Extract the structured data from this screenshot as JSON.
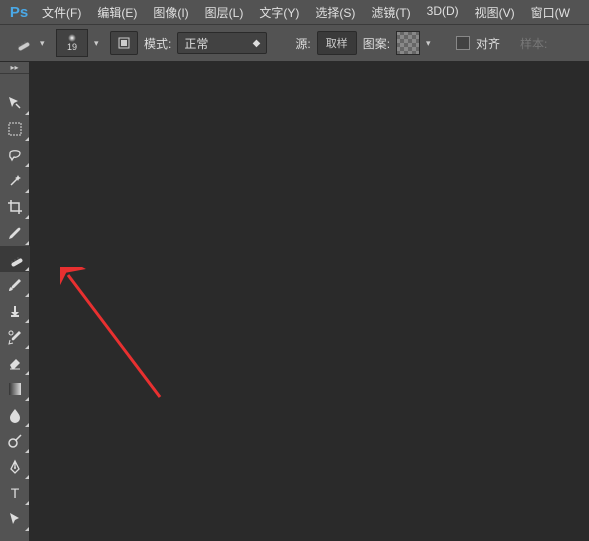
{
  "app": {
    "logo": "Ps"
  },
  "menu": {
    "file": "文件(F)",
    "edit": "编辑(E)",
    "image": "图像(I)",
    "layer": "图层(L)",
    "type": "文字(Y)",
    "select": "选择(S)",
    "filter": "滤镜(T)",
    "threeD": "3D(D)",
    "view": "视图(V)",
    "window": "窗口(W"
  },
  "options": {
    "brush_size": "19",
    "mode_label": "模式:",
    "mode_value": "正常",
    "source_label": "源:",
    "sample_btn": "取样",
    "pattern_btn": "图案:",
    "align_label": "对齐",
    "sample_label": "样本:"
  },
  "tools": {
    "selected_index": 7
  }
}
